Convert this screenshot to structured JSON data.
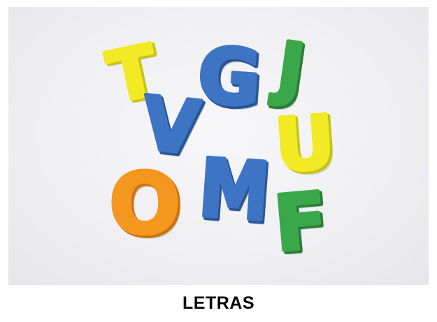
{
  "caption": "LETRAS",
  "letters": [
    {
      "char": "T",
      "color": "#f2ea24",
      "edge": "#c9c21a",
      "name": "foam-letter-t"
    },
    {
      "char": "V",
      "color": "#3d74c4",
      "edge": "#2b5696",
      "name": "foam-letter-v"
    },
    {
      "char": "G",
      "color": "#3d74c4",
      "edge": "#2b5696",
      "name": "foam-letter-g"
    },
    {
      "char": "J",
      "color": "#3aa84a",
      "edge": "#2a7d36",
      "name": "foam-letter-j"
    },
    {
      "char": "U",
      "color": "#f2ea24",
      "edge": "#c9c21a",
      "name": "foam-letter-u"
    },
    {
      "char": "O",
      "color": "#f5961f",
      "edge": "#c97414",
      "name": "foam-letter-o"
    },
    {
      "char": "M",
      "color": "#3d74c4",
      "edge": "#2b5696",
      "name": "foam-letter-m"
    },
    {
      "char": "F",
      "color": "#3aa84a",
      "edge": "#2a7d36",
      "name": "foam-letter-f"
    }
  ]
}
